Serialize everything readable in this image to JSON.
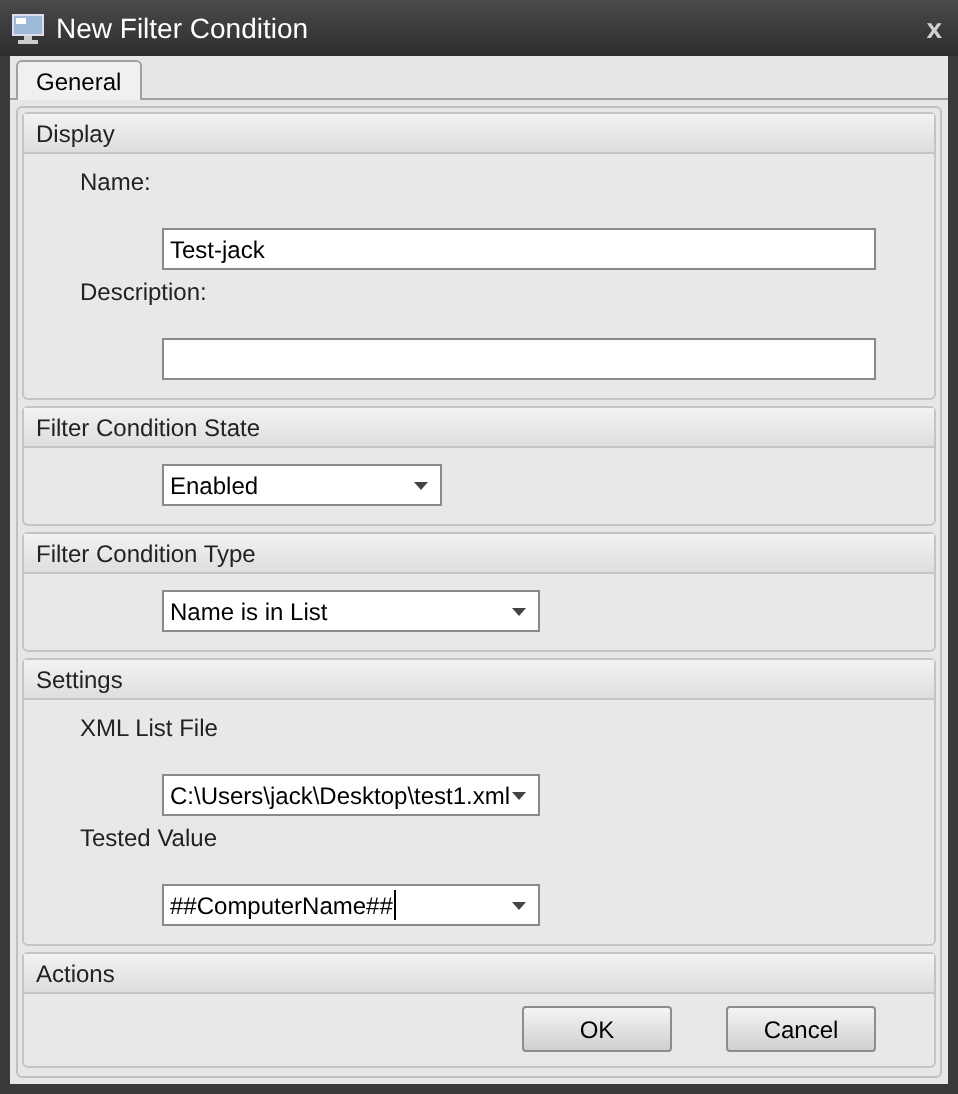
{
  "window": {
    "title": "New Filter Condition",
    "close": "x"
  },
  "tabs": [
    {
      "label": "General",
      "selected": true
    }
  ],
  "sections": [
    {
      "title": "Display",
      "items": [
        {
          "kind": "text",
          "label": "Name:",
          "value": "Test-jack"
        },
        {
          "kind": "text",
          "label": "Description:",
          "value": ""
        }
      ]
    },
    {
      "title": "Filter Condition State",
      "items": [
        {
          "kind": "dropdown",
          "value": "Enabled"
        }
      ]
    },
    {
      "title": "Filter Condition Type",
      "items": [
        {
          "kind": "dropdown",
          "value": "Name is in List"
        }
      ]
    },
    {
      "title": "Settings",
      "items": [
        {
          "kind": "dropdown",
          "label": "XML List File",
          "value": "C:\\Users\\jack\\Desktop\\test1.xml"
        },
        {
          "kind": "dropdown",
          "label": "Tested Value",
          "value": "##ComputerName##",
          "focused": true
        }
      ]
    },
    {
      "title": "Actions",
      "buttons": [
        "OK",
        "Cancel"
      ]
    }
  ]
}
